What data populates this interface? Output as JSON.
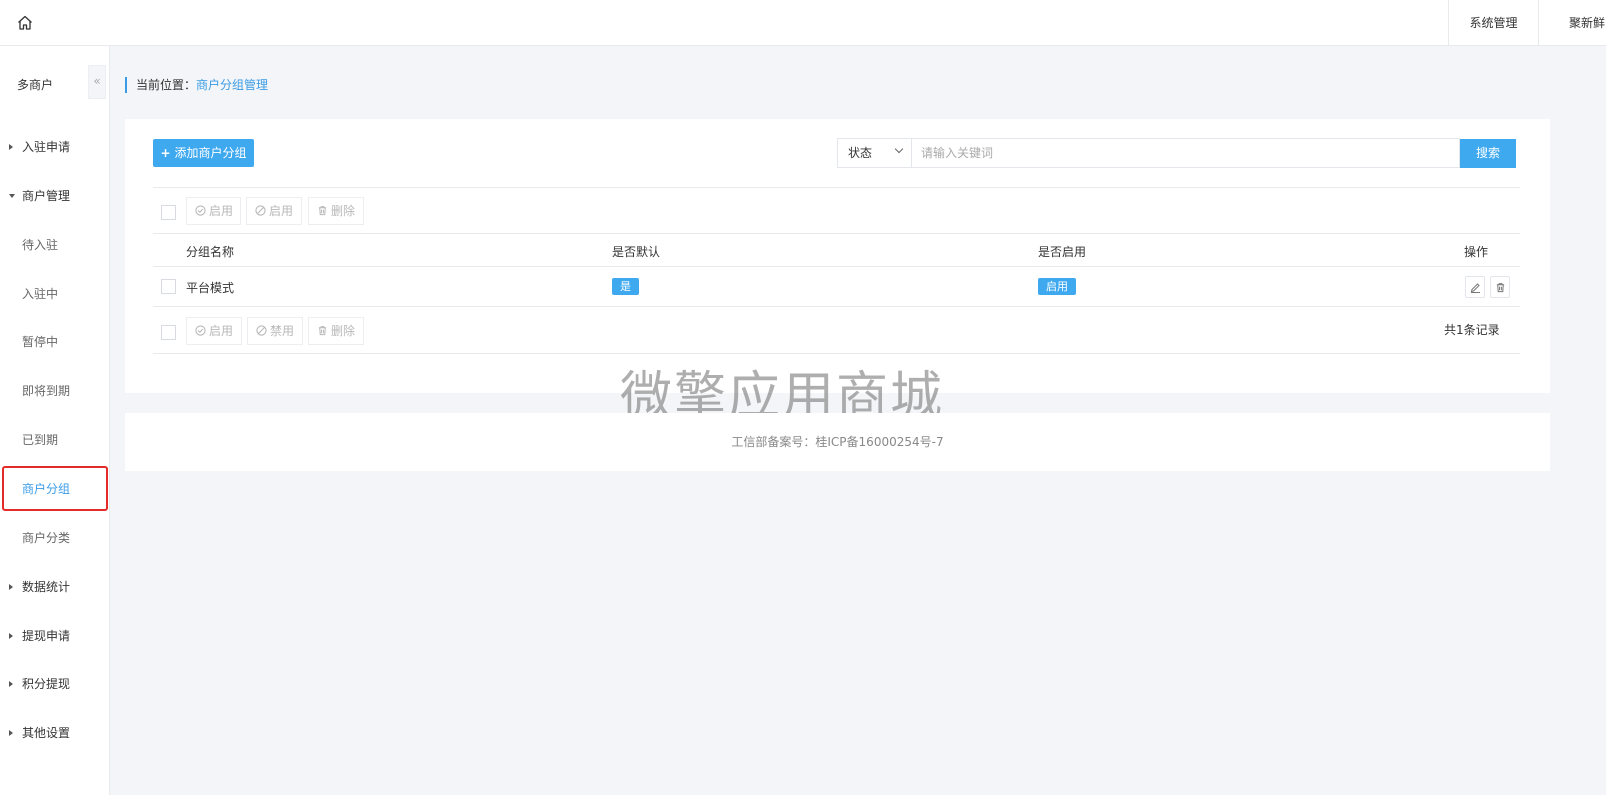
{
  "topbar": {
    "home_icon": "home-icon",
    "system_label": "系统管理",
    "user_label": "聚新鲜"
  },
  "sidebar": {
    "title": "多商户",
    "collapse_icon": "«",
    "items": [
      {
        "label": "入驻申请",
        "type": "group",
        "expanded": false
      },
      {
        "label": "商户管理",
        "type": "group",
        "expanded": true
      },
      {
        "label": "待入驻",
        "type": "sub"
      },
      {
        "label": "入驻中",
        "type": "sub"
      },
      {
        "label": "暂停中",
        "type": "sub"
      },
      {
        "label": "即将到期",
        "type": "sub"
      },
      {
        "label": "已到期",
        "type": "sub"
      },
      {
        "label": "商户分组",
        "type": "sub",
        "active": true
      },
      {
        "label": "商户分类",
        "type": "sub"
      },
      {
        "label": "数据统计",
        "type": "group",
        "expanded": false
      },
      {
        "label": "提现申请",
        "type": "group",
        "expanded": false
      },
      {
        "label": "积分提现",
        "type": "group",
        "expanded": false
      },
      {
        "label": "其他设置",
        "type": "group",
        "expanded": false
      }
    ]
  },
  "breadcrumb": {
    "prefix": "当前位置：",
    "current": "商户分组管理"
  },
  "toolbar": {
    "add_label": "添加商户分组",
    "status_select": "状态",
    "search_placeholder": "请输入关键词",
    "search_label": "搜索"
  },
  "bulk_top": {
    "enable_label": "启用",
    "disable_label": "启用",
    "delete_label": "删除"
  },
  "table": {
    "headers": [
      "分组名称",
      "是否默认",
      "是否启用",
      "操作"
    ],
    "rows": [
      {
        "name": "平台模式",
        "is_default": "是",
        "is_enabled": "启用"
      }
    ]
  },
  "bulk_bottom": {
    "enable_label": "启用",
    "disable_label": "禁用",
    "delete_label": "删除"
  },
  "pagination": {
    "total_text": "共1条记录"
  },
  "watermark": "微擎应用商城",
  "footer": {
    "icp_text": "工信部备案号：桂ICP备16000254号-7"
  },
  "colors": {
    "accent": "#3fa9f0",
    "highlight_border": "#e52a2a"
  }
}
